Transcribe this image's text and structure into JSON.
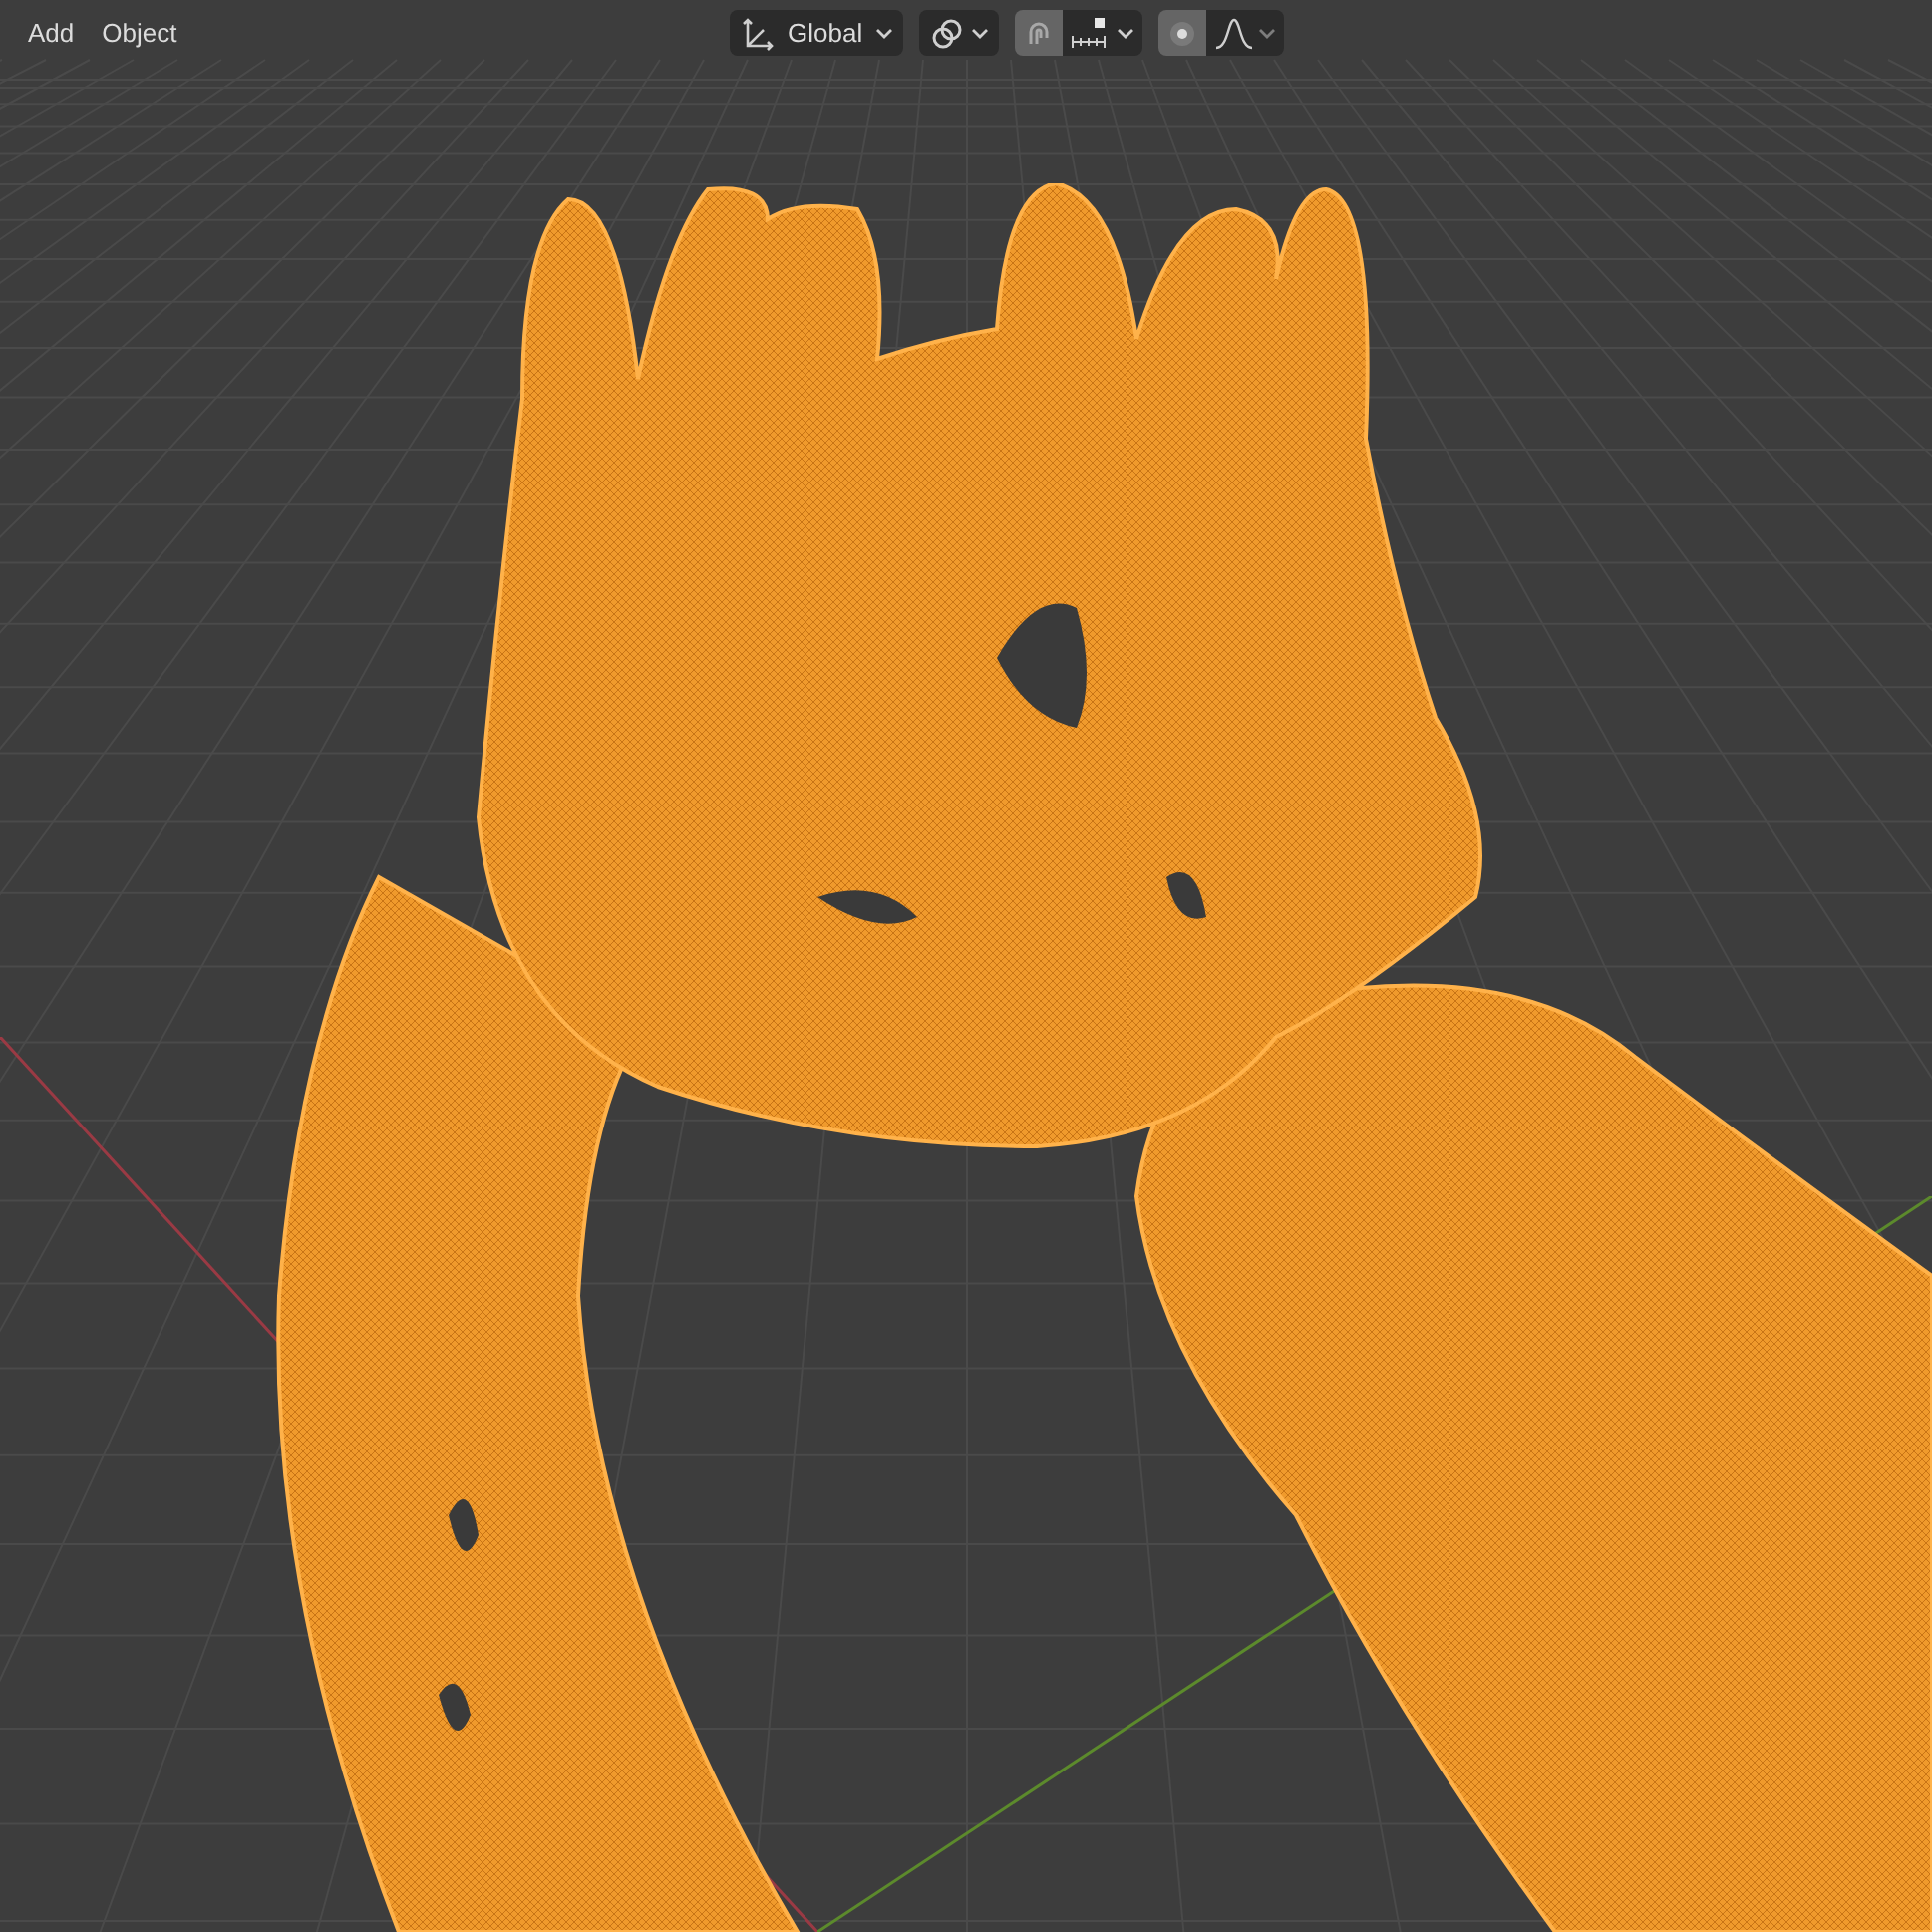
{
  "menu": [
    {
      "label": "Add"
    },
    {
      "label": "Object"
    }
  ],
  "toolbar": {
    "orientation": {
      "value": "Global"
    },
    "snap": {
      "on": true
    },
    "proportional_editing": {
      "on": true
    }
  }
}
